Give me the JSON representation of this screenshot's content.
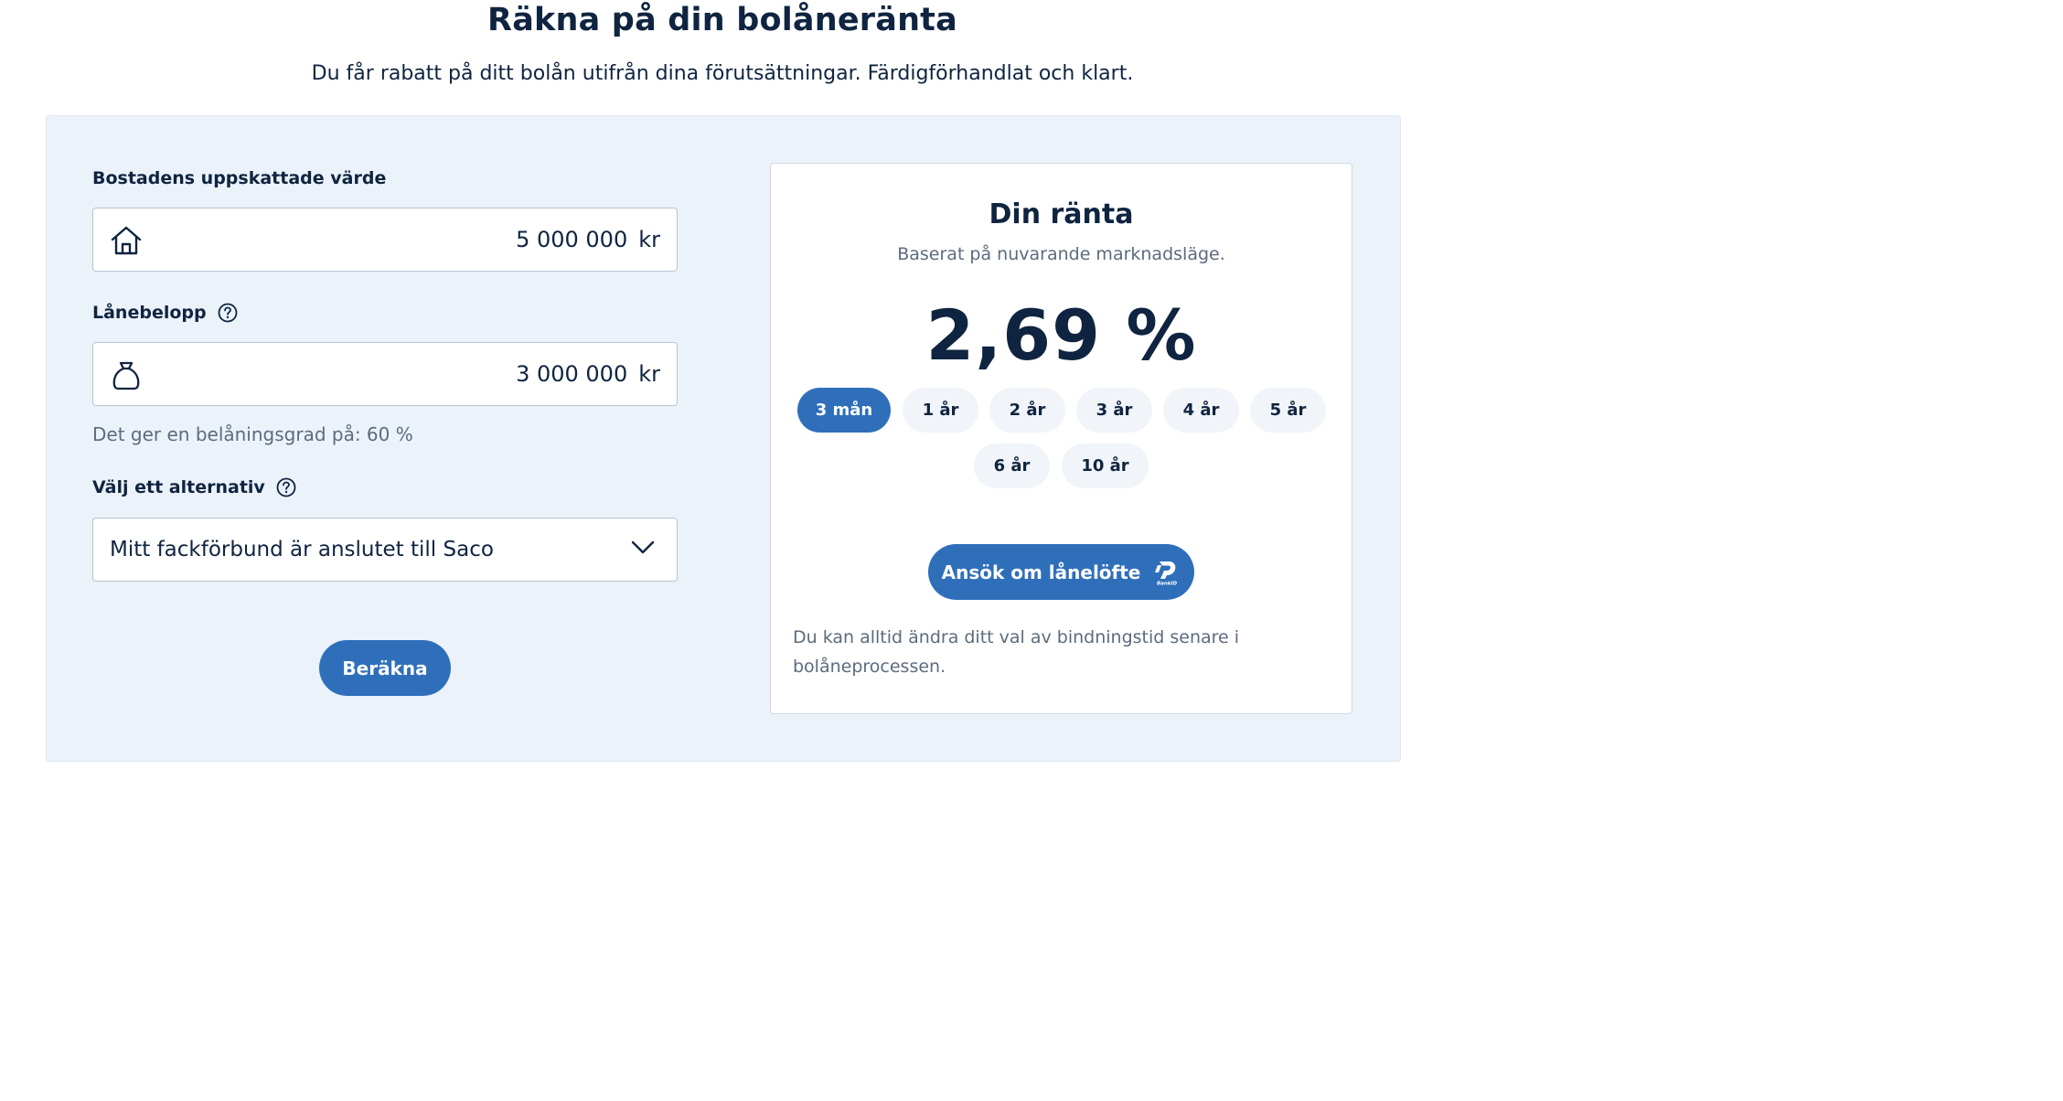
{
  "header": {
    "title": "Räkna på din bolåneränta",
    "subtitle": "Du får rabatt på ditt bolån utifrån dina förutsättningar. Färdigförhandlat och klart."
  },
  "form": {
    "property_value": {
      "label": "Bostadens uppskattade värde",
      "value": "5 000 000",
      "unit": "kr",
      "icon": "house-icon"
    },
    "loan_amount": {
      "label": "Lånebelopp",
      "value": "3 000 000",
      "unit": "kr",
      "icon": "money-bag-icon",
      "help_icon": "question-circle-icon"
    },
    "ltv_text": "Det ger en belåningsgrad på: 60 %",
    "option": {
      "label": "Välj ett alternativ",
      "selected": "Mitt fackförbund är anslutet till Saco",
      "help_icon": "question-circle-icon"
    },
    "calculate_label": "Beräkna"
  },
  "rate": {
    "title": "Din ränta",
    "subtitle": "Baserat på nuvarande marknadsläge.",
    "value": "2,69 %",
    "terms": [
      "3 mån",
      "1 år",
      "2 år",
      "3 år",
      "4 år",
      "5 år",
      "6 år",
      "10 år"
    ],
    "selected_term": "3 mån",
    "apply_label": "Ansök om lånelöfte",
    "apply_icon": "bankid-icon",
    "note": "Du kan alltid ändra ditt val av bindningstid senare i bolåneprocessen."
  },
  "colors": {
    "accent": "#2f6fba",
    "text": "#0f2440",
    "panel_bg": "#ebf2fa",
    "muted": "#5c6b7d"
  }
}
